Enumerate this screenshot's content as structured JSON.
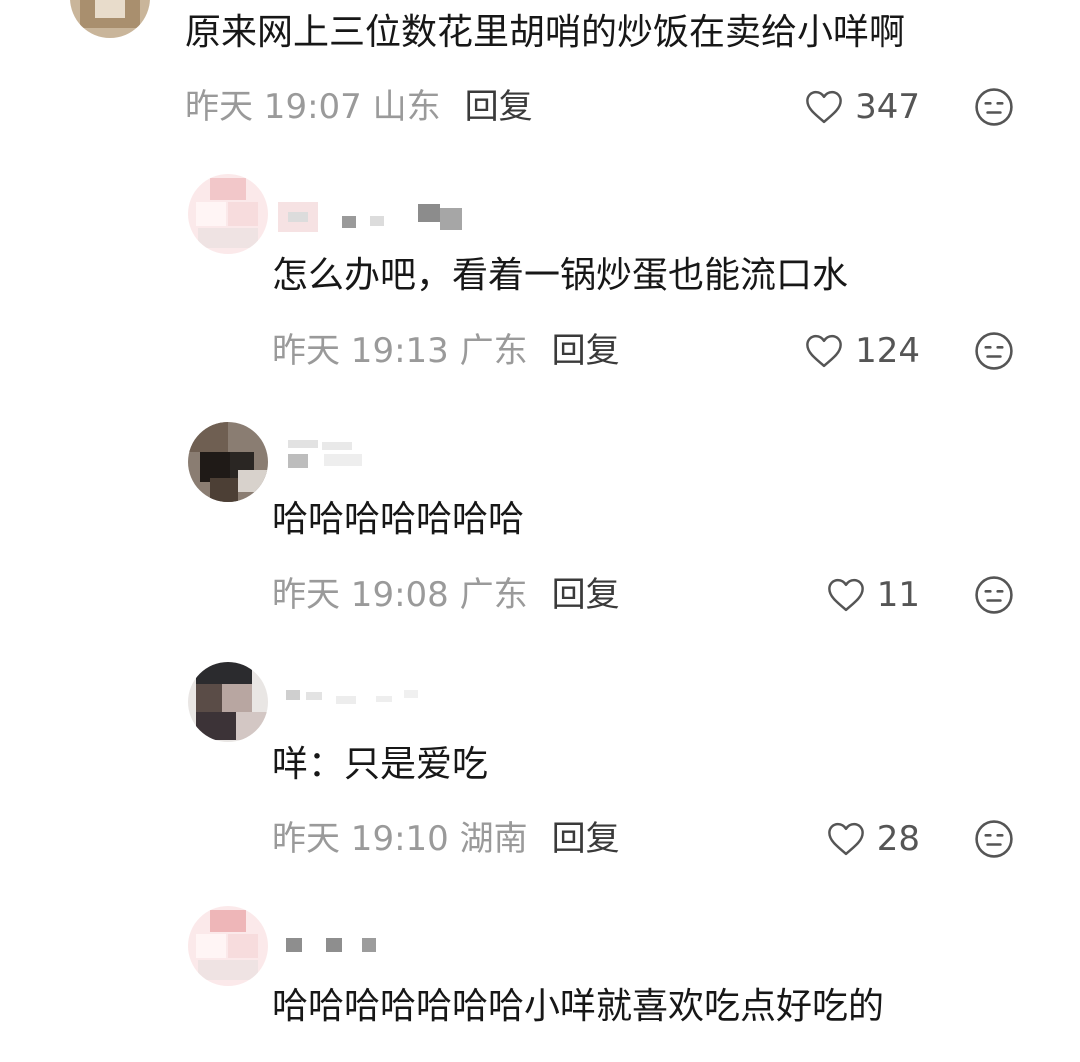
{
  "comments": [
    {
      "text": "原来网上三位数花里胡哨的炒饭在卖给小咩啊",
      "time": "昨天 19:07 山东",
      "reply": "回复",
      "likes": "347",
      "avatar_icon": "user-avatar-food-photo"
    },
    {
      "text": "怎么办吧，看着一锅炒蛋也能流口水",
      "time": "昨天 19:13 广东",
      "reply": "回复",
      "likes": "124",
      "avatar_icon": "user-avatar-pixelated-pink"
    },
    {
      "text": "哈哈哈哈哈哈哈",
      "time": "昨天 19:08 广东",
      "reply": "回复",
      "likes": "11",
      "avatar_icon": "user-avatar-pixelated-dark"
    },
    {
      "text": "咩：只是爱吃",
      "time": "昨天 19:10 湖南",
      "reply": "回复",
      "likes": "28",
      "avatar_icon": "user-avatar-pixelated-portrait"
    },
    {
      "text": "哈哈哈哈哈哈哈小咩就喜欢吃点好吃的",
      "time": "",
      "reply": "",
      "likes": "",
      "avatar_icon": "user-avatar-pixelated-pink"
    }
  ],
  "icons": {
    "like": "heart-outline-icon",
    "emoji": "neutral-face-icon"
  },
  "colors": {
    "meta_text": "#9a9a9a",
    "body_text": "#171717",
    "icon_stroke": "#555555"
  }
}
